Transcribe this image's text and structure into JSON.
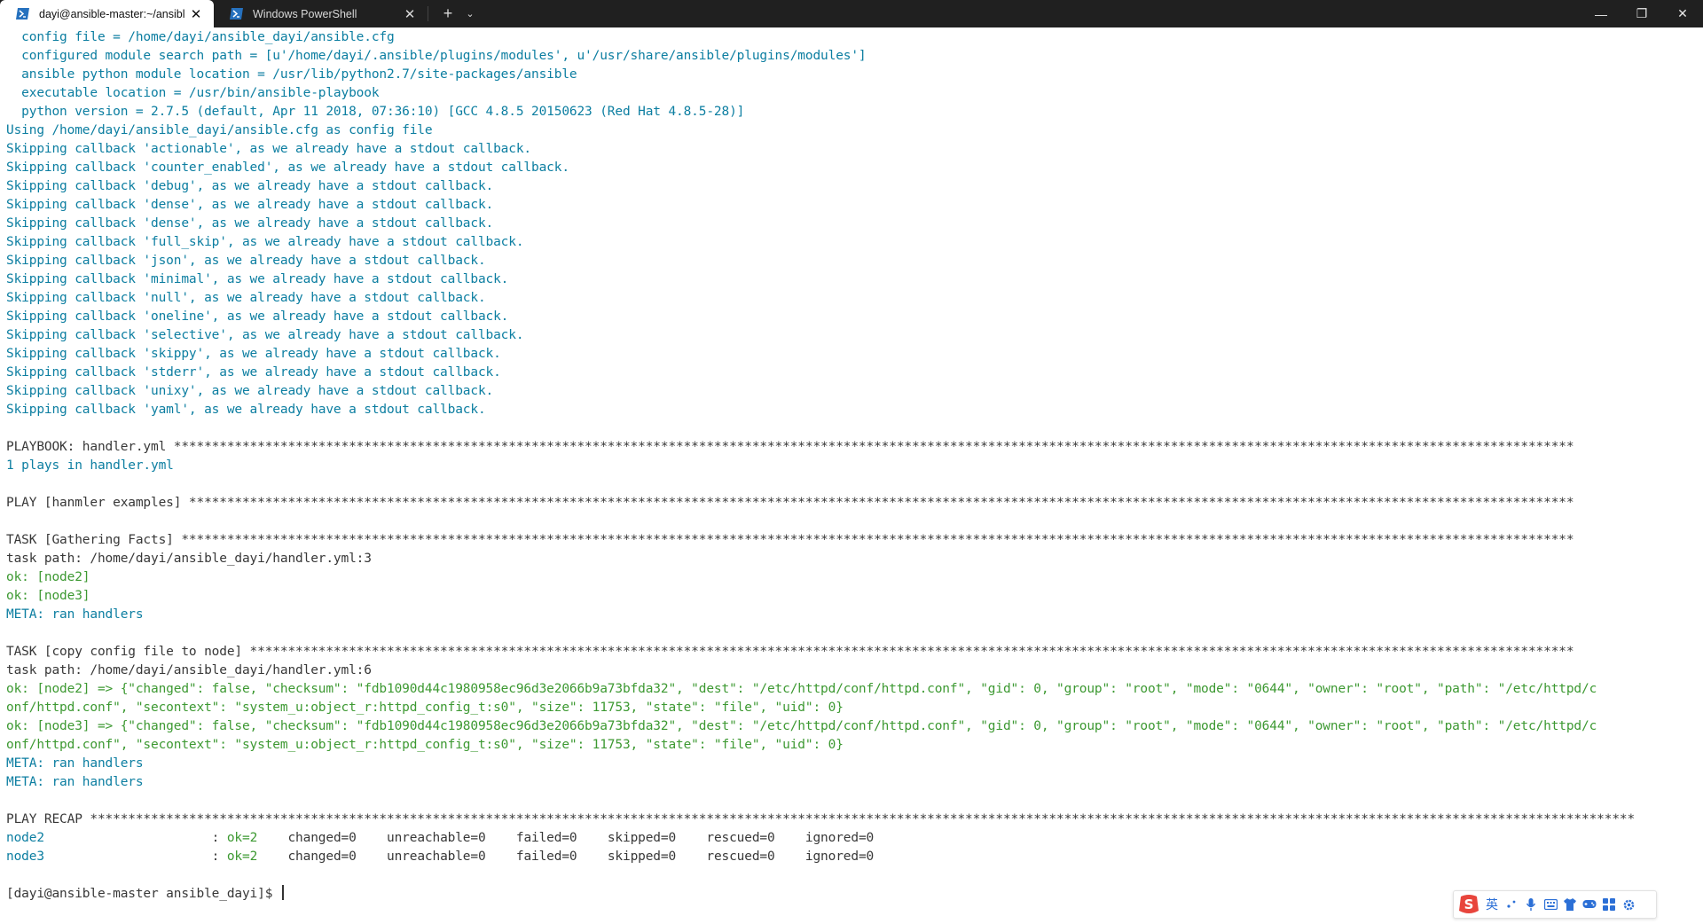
{
  "window": {
    "tabs": [
      {
        "label": "dayi@ansible-master:~/ansibl",
        "active": true,
        "icon": "powershell-icon"
      },
      {
        "label": "Windows PowerShell",
        "active": false,
        "icon": "powershell-icon"
      }
    ],
    "new_tab_glyph": "+",
    "dropdown_glyph": "⌄",
    "close_glyph": "✕",
    "controls": {
      "minimize": "—",
      "maximize": "❐",
      "close": "✕"
    }
  },
  "colors": {
    "info_blue": "#0c7ea1",
    "ok_green": "#3d9932",
    "default_text": "#383838",
    "titlebar_bg": "#202020",
    "ime_blue": "#2b6fd6",
    "ime_logo_red": "#e8453c"
  },
  "terminal": {
    "lines": [
      {
        "text": "  config file = /home/dayi/ansible_dayi/ansible.cfg",
        "color": "blue"
      },
      {
        "text": "  configured module search path = [u'/home/dayi/.ansible/plugins/modules', u'/usr/share/ansible/plugins/modules']",
        "color": "blue"
      },
      {
        "text": "  ansible python module location = /usr/lib/python2.7/site-packages/ansible",
        "color": "blue"
      },
      {
        "text": "  executable location = /usr/bin/ansible-playbook",
        "color": "blue"
      },
      {
        "text": "  python version = 2.7.5 (default, Apr 11 2018, 07:36:10) [GCC 4.8.5 20150623 (Red Hat 4.8.5-28)]",
        "color": "blue"
      },
      {
        "text": "Using /home/dayi/ansible_dayi/ansible.cfg as config file",
        "color": "blue"
      },
      {
        "text": "Skipping callback 'actionable', as we already have a stdout callback.",
        "color": "blue"
      },
      {
        "text": "Skipping callback 'counter_enabled', as we already have a stdout callback.",
        "color": "blue"
      },
      {
        "text": "Skipping callback 'debug', as we already have a stdout callback.",
        "color": "blue"
      },
      {
        "text": "Skipping callback 'dense', as we already have a stdout callback.",
        "color": "blue"
      },
      {
        "text": "Skipping callback 'dense', as we already have a stdout callback.",
        "color": "blue"
      },
      {
        "text": "Skipping callback 'full_skip', as we already have a stdout callback.",
        "color": "blue"
      },
      {
        "text": "Skipping callback 'json', as we already have a stdout callback.",
        "color": "blue"
      },
      {
        "text": "Skipping callback 'minimal', as we already have a stdout callback.",
        "color": "blue"
      },
      {
        "text": "Skipping callback 'null', as we already have a stdout callback.",
        "color": "blue"
      },
      {
        "text": "Skipping callback 'oneline', as we already have a stdout callback.",
        "color": "blue"
      },
      {
        "text": "Skipping callback 'selective', as we already have a stdout callback.",
        "color": "blue"
      },
      {
        "text": "Skipping callback 'skippy', as we already have a stdout callback.",
        "color": "blue"
      },
      {
        "text": "Skipping callback 'stderr', as we already have a stdout callback.",
        "color": "blue"
      },
      {
        "text": "Skipping callback 'unixy', as we already have a stdout callback.",
        "color": "blue"
      },
      {
        "text": "Skipping callback 'yaml', as we already have a stdout callback.",
        "color": "blue"
      },
      {
        "text": "",
        "color": "dark"
      },
      {
        "text": "PLAYBOOK: handler.yml ****************************************************************************************************************************************************************************************",
        "color": "dark"
      },
      {
        "text": "1 plays in handler.yml",
        "color": "blue"
      },
      {
        "text": "",
        "color": "dark"
      },
      {
        "text": "PLAY [hanmler examples] **************************************************************************************************************************************************************************************",
        "color": "dark"
      },
      {
        "text": "",
        "color": "dark"
      },
      {
        "text": "TASK [Gathering Facts] ***************************************************************************************************************************************************************************************",
        "color": "dark"
      },
      {
        "text": "task path: /home/dayi/ansible_dayi/handler.yml:3",
        "color": "dark"
      },
      {
        "text": "ok: [node2]",
        "color": "green"
      },
      {
        "text": "ok: [node3]",
        "color": "green"
      },
      {
        "text": "META: ran handlers",
        "color": "blue"
      },
      {
        "text": "",
        "color": "dark"
      },
      {
        "text": "TASK [copy config file to node] ******************************************************************************************************************************************************************************",
        "color": "dark"
      },
      {
        "text": "task path: /home/dayi/ansible_dayi/handler.yml:6",
        "color": "dark"
      },
      {
        "text": "ok: [node2] => {\"changed\": false, \"checksum\": \"fdb1090d44c1980958ec96d3e2066b9a73bfda32\", \"dest\": \"/etc/httpd/conf/httpd.conf\", \"gid\": 0, \"group\": \"root\", \"mode\": \"0644\", \"owner\": \"root\", \"path\": \"/etc/httpd/c",
        "color": "green"
      },
      {
        "text": "onf/httpd.conf\", \"secontext\": \"system_u:object_r:httpd_config_t:s0\", \"size\": 11753, \"state\": \"file\", \"uid\": 0}",
        "color": "green"
      },
      {
        "text": "ok: [node3] => {\"changed\": false, \"checksum\": \"fdb1090d44c1980958ec96d3e2066b9a73bfda32\", \"dest\": \"/etc/httpd/conf/httpd.conf\", \"gid\": 0, \"group\": \"root\", \"mode\": \"0644\", \"owner\": \"root\", \"path\": \"/etc/httpd/c",
        "color": "green"
      },
      {
        "text": "onf/httpd.conf\", \"secontext\": \"system_u:object_r:httpd_config_t:s0\", \"size\": 11753, \"state\": \"file\", \"uid\": 0}",
        "color": "green"
      },
      {
        "text": "META: ran handlers",
        "color": "blue"
      },
      {
        "text": "META: ran handlers",
        "color": "blue"
      },
      {
        "text": "",
        "color": "dark"
      },
      {
        "text": "PLAY RECAP ***********************************************************************************************************************************************************************************************************",
        "color": "dark"
      }
    ],
    "recap": [
      {
        "host": "node2",
        "ok": "ok=2",
        "rest": "    changed=0    unreachable=0    failed=0    skipped=0    rescued=0    ignored=0"
      },
      {
        "host": "node3",
        "ok": "ok=2",
        "rest": "    changed=0    unreachable=0    failed=0    skipped=0    rescued=0    ignored=0"
      }
    ],
    "prompt": "[dayi@ansible-master ansible_dayi]$ "
  },
  "ime_toolbar": {
    "logo": "sogou-logo-icon",
    "lang": "英",
    "items": [
      "punctuation-icon",
      "microphone-icon",
      "keyboard-icon",
      "skin-icon",
      "game-icon",
      "toolbox-icon",
      "settings-icon"
    ]
  }
}
